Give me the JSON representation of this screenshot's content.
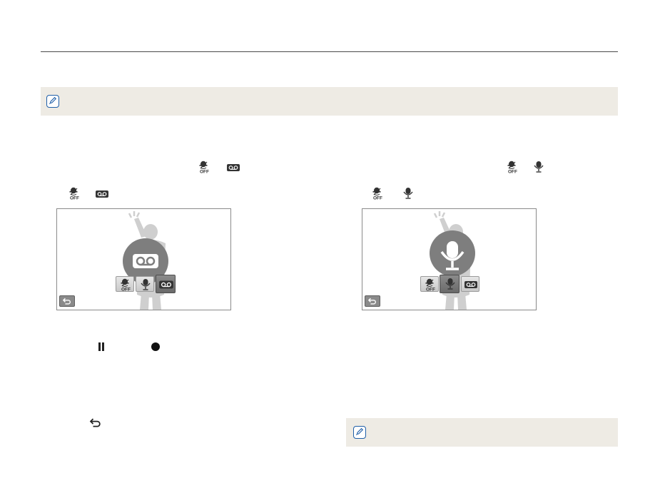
{
  "page": {
    "header_rule": true
  },
  "notes": [
    {
      "icon": "note-pencil-icon",
      "text": ""
    },
    {
      "icon": "note-pencil-icon",
      "text": ""
    }
  ],
  "left_panel": {
    "step_icons_line1": [
      "voice-off-icon",
      "voice-memo-icon"
    ],
    "step_icons_line2": [
      "voice-off-icon",
      "voice-memo-icon"
    ],
    "screen": {
      "selected_mode": "voice-memo",
      "modes": [
        "voice-off",
        "voice-record",
        "voice-memo"
      ]
    },
    "controls": [
      "pause-icon",
      "record-icon"
    ],
    "back_step_icon": "back-icon"
  },
  "right_panel": {
    "step_icons_line1": [
      "voice-off-icon",
      "voice-record-icon"
    ],
    "step_icons_line2": [
      "voice-off-icon",
      "voice-record-icon"
    ],
    "screen": {
      "selected_mode": "voice-record",
      "modes": [
        "voice-off",
        "voice-record",
        "voice-memo"
      ]
    }
  },
  "colors": {
    "note_bg": "#eeebe4",
    "note_icon": "#1f5fa8",
    "figure_gray": "#c9c9c9",
    "selected_circle": "#7e7e7e"
  }
}
